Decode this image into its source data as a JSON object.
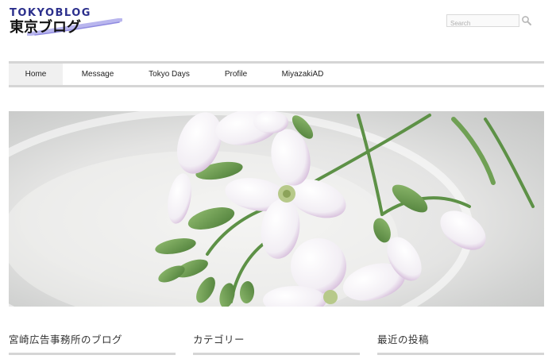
{
  "logo": {
    "line1": "TOKYOBLOG",
    "line2": "東京ブログ",
    "accent_color": "#2b2f8c"
  },
  "search": {
    "placeholder": "Search",
    "value": "",
    "icon": "search-icon"
  },
  "nav": {
    "items": [
      {
        "label": "Home",
        "active": true
      },
      {
        "label": "Message",
        "active": false
      },
      {
        "label": "Tokyo Days",
        "active": false
      },
      {
        "label": "Profile",
        "active": false
      },
      {
        "label": "MiyazakiAD",
        "active": false
      }
    ]
  },
  "hero": {
    "subject": "white-lilac radish flowers on a white plate"
  },
  "widgets": [
    {
      "title": "宮崎広告事務所のブログ"
    },
    {
      "title": "カテゴリー"
    },
    {
      "title": "最近の投稿"
    }
  ]
}
